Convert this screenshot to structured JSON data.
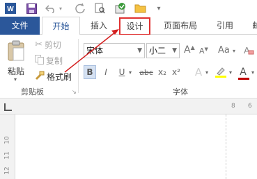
{
  "qat": {
    "icons": [
      "word-logo-icon",
      "save-icon",
      "undo-icon",
      "redo-icon",
      "print-preview-icon",
      "check-icon",
      "folder-icon",
      "customize-qat-icon"
    ]
  },
  "tabs": {
    "file": "文件",
    "home": "开始",
    "insert": "插入",
    "design": "设计",
    "layout": "页面布局",
    "references": "引用",
    "mailings": "邮"
  },
  "clipboard": {
    "paste": "粘贴",
    "cut": "剪切",
    "copy": "复制",
    "format_painter": "格式刷",
    "group_label": "剪贴板"
  },
  "font": {
    "font_name": "宋体",
    "font_size": "小二",
    "grow_label": "A",
    "shrink_label": "A",
    "case_label": "Aa",
    "bold": "B",
    "italic": "I",
    "underline": "U",
    "strike": "abc",
    "subscript": "x₂",
    "superscript": "x²",
    "effects": "A",
    "font_color": "A",
    "group_label": "字体",
    "highlight_color": "#ffff00",
    "font_color_value": "#c00000"
  },
  "ruler": {
    "top_numbers": [
      "8",
      "6"
    ],
    "left_numbers": [
      "10",
      "11",
      "12"
    ]
  },
  "colors": {
    "file_tab": "#2b579a",
    "design_highlight": "#e03030"
  }
}
